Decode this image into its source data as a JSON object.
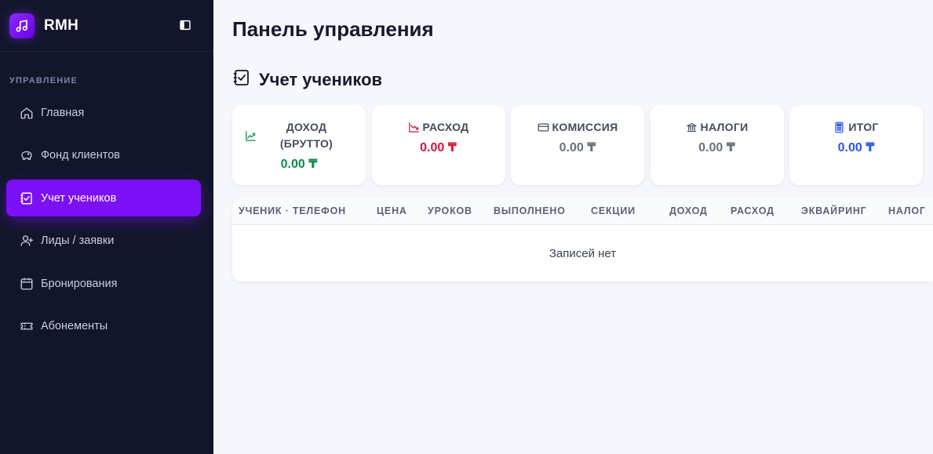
{
  "brand": {
    "name": "RMH"
  },
  "sidebar": {
    "section_label": "УПРАВЛЕНИЕ",
    "items": [
      {
        "label": "Главная",
        "icon": "home-icon"
      },
      {
        "label": "Фонд клиентов",
        "icon": "piggy-bank-icon"
      },
      {
        "label": "Учет учеников",
        "icon": "checklist-icon",
        "active": true
      },
      {
        "label": "Лиды / заявки",
        "icon": "user-plus-icon"
      },
      {
        "label": "Бронирования",
        "icon": "calendar-icon"
      },
      {
        "label": "Абонементы",
        "icon": "ticket-icon"
      }
    ]
  },
  "main": {
    "page_title": "Панель управления",
    "section_title": "Учет учеников",
    "cards": [
      {
        "label": "ДОХОД (БРУТТО)",
        "value": "0.00 ₸",
        "color": "#0f8a4b",
        "icon": "trend-up-icon"
      },
      {
        "label": "РАСХОД",
        "value": "0.00 ₸",
        "color": "#d8143c",
        "icon": "trend-down-icon"
      },
      {
        "label": "КОМИССИЯ",
        "value": "0.00 ₸",
        "color": "#6b7080",
        "icon": "credit-card-icon"
      },
      {
        "label": "НАЛОГИ",
        "value": "0.00 ₸",
        "color": "#6b7080",
        "icon": "bank-icon"
      },
      {
        "label": "ИТОГ",
        "value": "0.00 ₸",
        "color": "#2b59e6",
        "icon": "calculator-icon"
      }
    ],
    "table": {
      "columns": [
        "УЧЕНИК · ТЕЛЕФОН",
        "ЦЕНА",
        "УРОКОВ",
        "ВЫПОЛНЕНО",
        "СЕКЦИИ",
        "ДОХОД",
        "РАСХОД",
        "ЭКВАЙРИНГ",
        "НАЛОГ"
      ],
      "empty_text": "Записей нет"
    }
  },
  "colors": {
    "accent": "#7b0ff5",
    "sidebar_bg": "#12162b"
  }
}
